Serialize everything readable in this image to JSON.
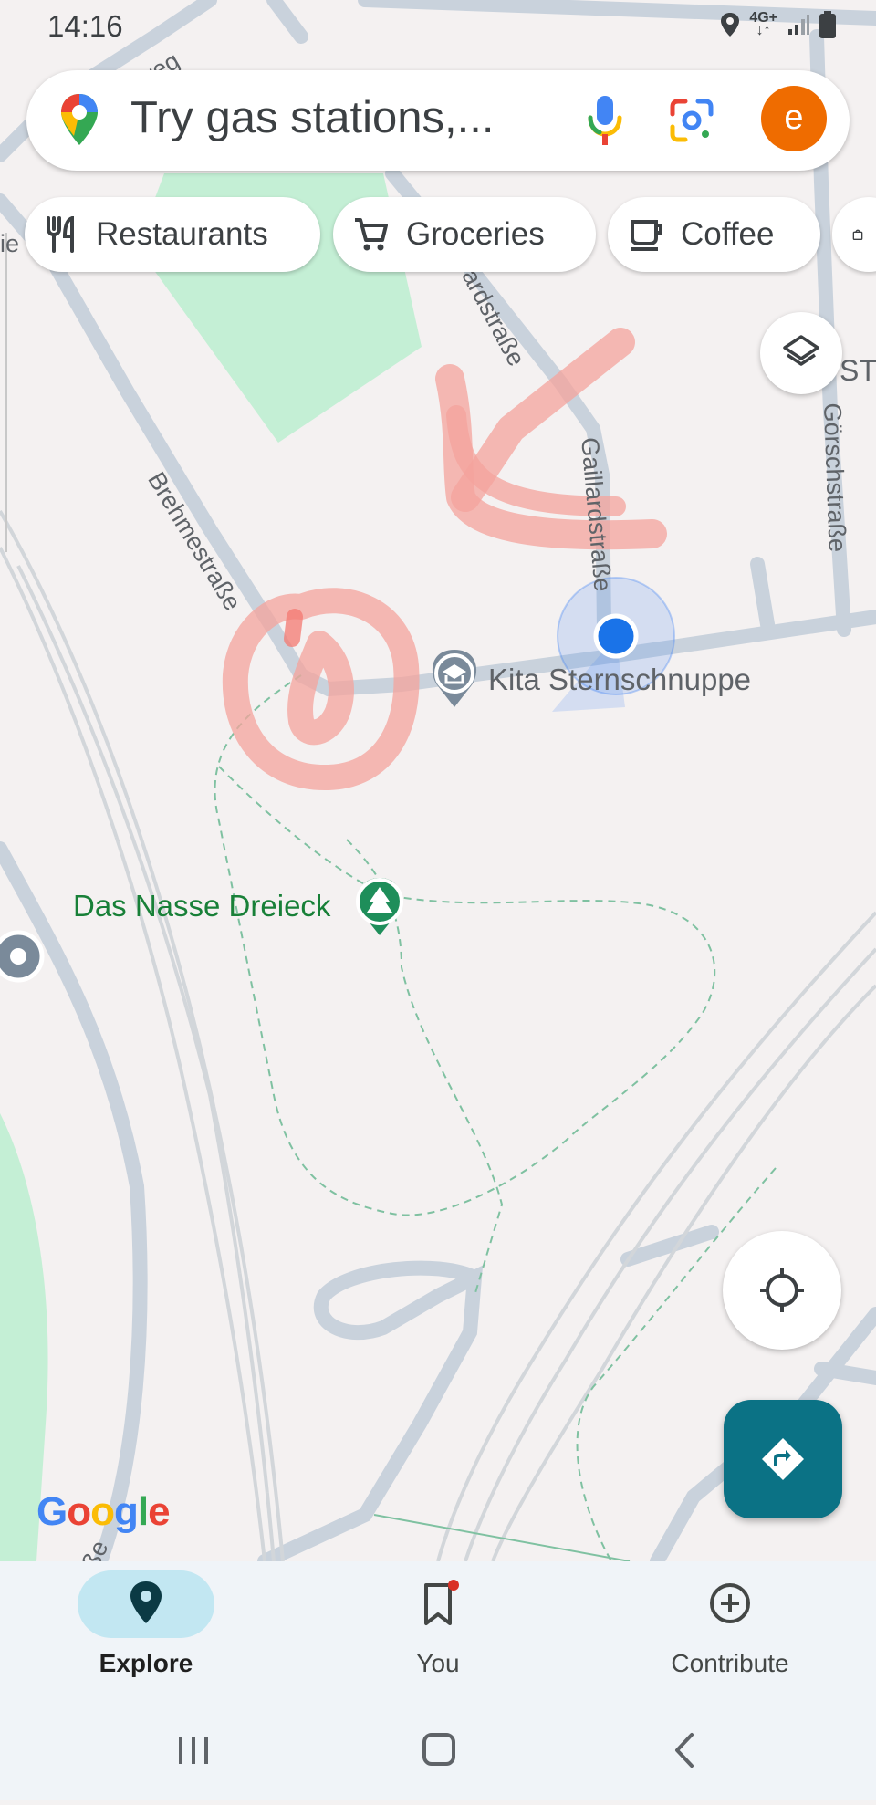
{
  "status_bar": {
    "time": "14:16",
    "network": "4G+"
  },
  "search": {
    "placeholder_text": "Try gas stations,...",
    "avatar_letter": "e"
  },
  "chips": [
    {
      "label": "Restaurants",
      "icon": "fork-knife-icon"
    },
    {
      "label": "Groceries",
      "icon": "cart-icon"
    },
    {
      "label": "Coffee",
      "icon": "coffee-cup-icon"
    }
  ],
  "map": {
    "pois": {
      "kita": "Kita Sternschnuppe",
      "park": "Das Nasse Dreieck"
    },
    "streets": {
      "brehme": "Brehmestraße",
      "gaillard": "Gaillardstraße",
      "gaillard_top": "ardstraße",
      "goersch": "Görschstraße",
      "weg": "weg",
      "top_left": "ie",
      "right_partial": "ST",
      "bottom_left": "ße"
    },
    "logo_letters": [
      "G",
      "o",
      "o",
      "g",
      "l",
      "e"
    ],
    "logo_colors": [
      "#4285f4",
      "#ea4335",
      "#fbbc05",
      "#4285f4",
      "#34a853",
      "#ea4335"
    ]
  },
  "bottom_nav": [
    {
      "label": "Explore",
      "active": true
    },
    {
      "label": "You",
      "active": false,
      "badge": true
    },
    {
      "label": "Contribute",
      "active": false
    }
  ],
  "colors": {
    "accent_teal": "#0b7285",
    "avatar": "#ef6c00",
    "park_green": "#188038",
    "annotation_red": "#f28b82"
  }
}
